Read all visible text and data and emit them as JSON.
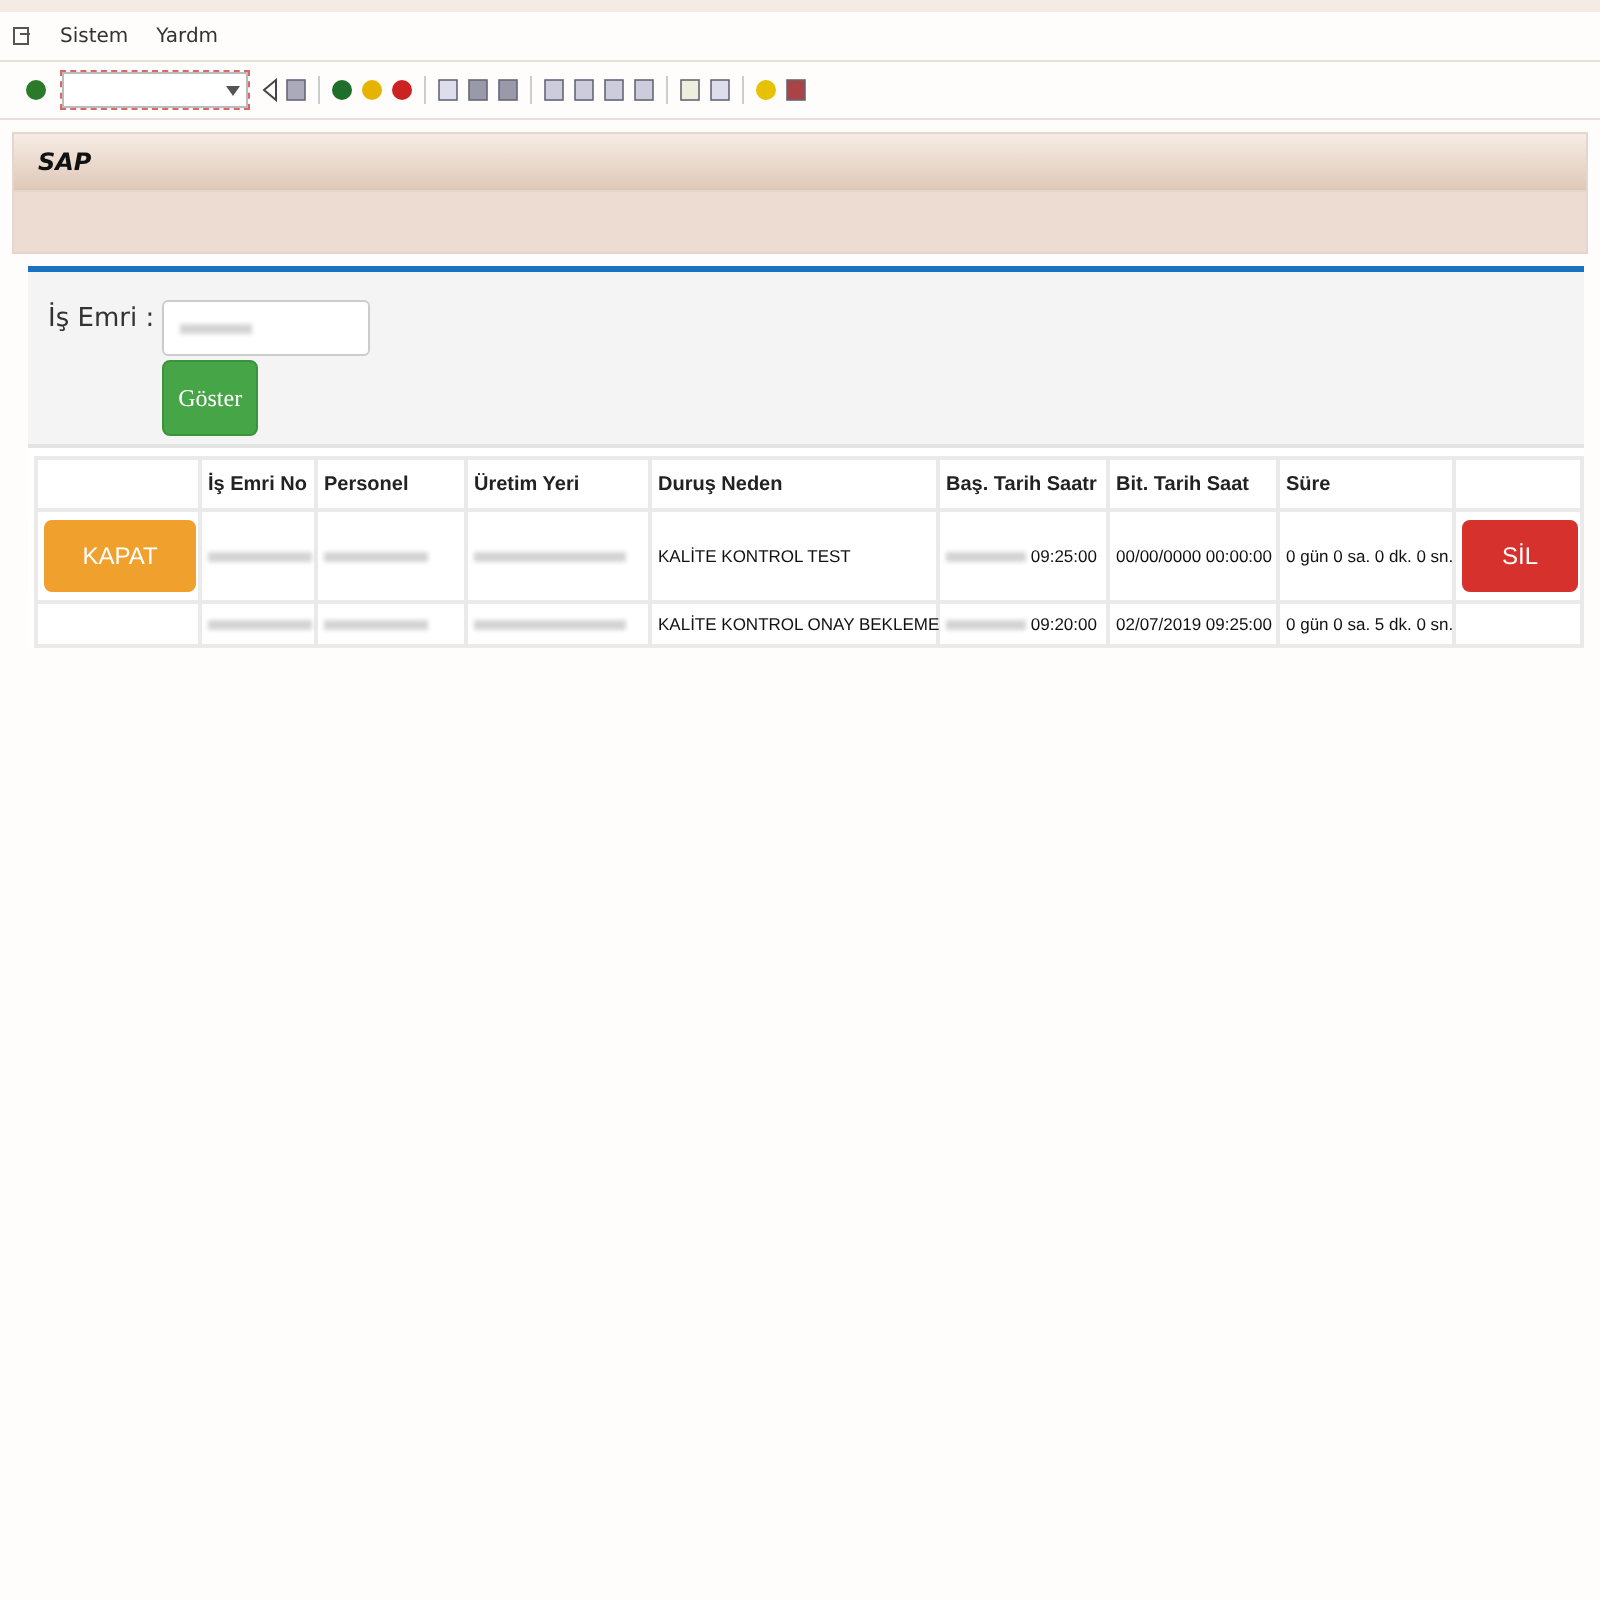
{
  "menu": [
    "Sistem",
    "Yardm"
  ],
  "header": {
    "title": "SAP"
  },
  "form": {
    "label": "İş Emri :",
    "button": "Göster"
  },
  "table": {
    "columns": [
      "",
      "İş Emri No",
      "Personel",
      "Üretim Yeri",
      "Duruş Neden",
      "Baş. Tarih Saatr",
      "Bit. Tarih Saat",
      "Süre",
      ""
    ],
    "rows": [
      {
        "close_button": "KAPAT",
        "reason": "KALİTE KONTROL TEST",
        "start_time": "09:25:00",
        "end": "00/00/0000 00:00:00",
        "duration": "0 gün 0 sa. 0 dk. 0 sn.",
        "delete_button": "SİL"
      },
      {
        "reason": "KALİTE KONTROL ONAY BEKLEME",
        "start_time": "09:20:00",
        "end": "02/07/2019 09:25:00",
        "duration": "0 gün 0 sa. 5 dk. 0 sn."
      }
    ]
  }
}
